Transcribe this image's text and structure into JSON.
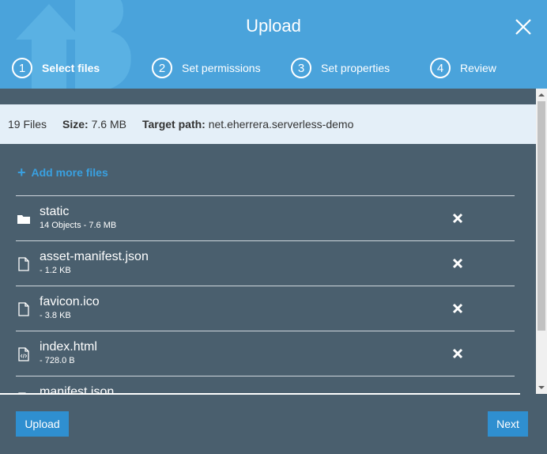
{
  "header": {
    "title": "Upload",
    "steps": [
      {
        "num": "1",
        "label": "Select files",
        "active": true
      },
      {
        "num": "2",
        "label": "Set permissions",
        "active": false
      },
      {
        "num": "3",
        "label": "Set properties",
        "active": false
      },
      {
        "num": "4",
        "label": "Review",
        "active": false
      }
    ]
  },
  "summary": {
    "files": "19 Files",
    "size_label": "Size:",
    "size_value": "7.6 MB",
    "target_label": "Target path:",
    "target_value": "net.eherrera.serverless-demo"
  },
  "add_more_label": "Add more files",
  "files": [
    {
      "name": "static",
      "meta": "14 Objects - 7.6 MB",
      "icon": "folder-icon"
    },
    {
      "name": "asset-manifest.json",
      "meta": "- 1.2 KB",
      "icon": "file-icon"
    },
    {
      "name": "favicon.ico",
      "meta": "- 3.8 KB",
      "icon": "file-icon"
    },
    {
      "name": "index.html",
      "meta": "- 728.0 B",
      "icon": "code-file-icon"
    },
    {
      "name": "manifest.json",
      "meta": "",
      "icon": "file-icon"
    }
  ],
  "footer": {
    "upload_label": "Upload",
    "next_label": "Next"
  },
  "colors": {
    "header_bg": "#4aa3db",
    "body_bg": "#4a5f6e",
    "infobar_bg": "#e4eff8",
    "accent_link": "#39a0e0",
    "button_bg": "#2f8fd0"
  }
}
